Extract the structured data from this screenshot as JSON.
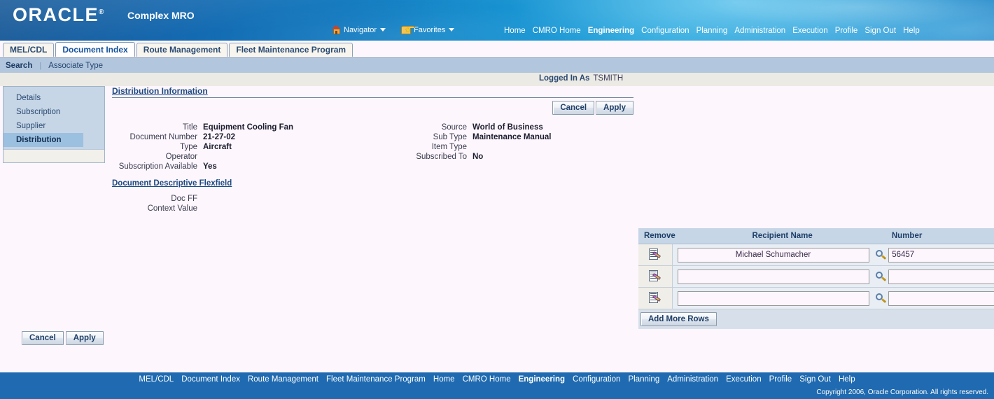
{
  "branding": {
    "logo_text": "ORACLE",
    "logo_registered": "®",
    "app_title": "Complex MRO"
  },
  "global_tools": [
    {
      "label": "Navigator",
      "icon": "house-icon"
    },
    {
      "label": "Favorites",
      "icon": "folder-star-icon"
    }
  ],
  "global_nav": [
    {
      "label": "Home",
      "current": false
    },
    {
      "label": "CMRO Home",
      "current": false
    },
    {
      "label": "Engineering",
      "current": true
    },
    {
      "label": "Configuration",
      "current": false
    },
    {
      "label": "Planning",
      "current": false
    },
    {
      "label": "Administration",
      "current": false
    },
    {
      "label": "Execution",
      "current": false
    },
    {
      "label": "Profile",
      "current": false
    },
    {
      "label": "Sign Out",
      "current": false
    },
    {
      "label": "Help",
      "current": false
    }
  ],
  "tabs": [
    {
      "label": "MEL/CDL",
      "selected": false
    },
    {
      "label": "Document Index",
      "selected": true
    },
    {
      "label": "Route Management",
      "selected": false
    },
    {
      "label": "Fleet Maintenance Program",
      "selected": false
    }
  ],
  "subtabs": [
    {
      "label": "Search",
      "selected": true
    },
    {
      "label": "Associate Type",
      "selected": false
    }
  ],
  "login": {
    "label": "Logged In As",
    "user": "TSMITH"
  },
  "sidemenu": {
    "items": [
      {
        "label": "Details",
        "selected": false
      },
      {
        "label": "Subscription",
        "selected": false
      },
      {
        "label": "Supplier",
        "selected": false
      },
      {
        "label": "Distribution",
        "selected": true
      }
    ]
  },
  "section": {
    "title": "Distribution Information",
    "cancel_label": "Cancel",
    "apply_label": "Apply"
  },
  "fields": {
    "left": [
      {
        "label": "Title",
        "value": "Equipment Cooling Fan"
      },
      {
        "label": "Document Number",
        "value": "21-27-02"
      },
      {
        "label": "Type",
        "value": "Aircraft"
      },
      {
        "label": "Operator",
        "value": ""
      },
      {
        "label": "Subscription Available",
        "value": "Yes"
      }
    ],
    "right": [
      {
        "label": "Source",
        "value": "World of Business"
      },
      {
        "label": "Sub Type",
        "value": "Maintenance Manual"
      },
      {
        "label": "Item Type",
        "value": ""
      },
      {
        "label": "Subscribed To",
        "value": "No"
      }
    ]
  },
  "flexfield": {
    "title": "Document Descriptive Flexfield",
    "rows": [
      {
        "label": "Doc FF",
        "value": ""
      },
      {
        "label": "Context Value",
        "value": ""
      }
    ]
  },
  "recipients": {
    "headers": {
      "remove": "Remove",
      "name": "Recipient Name",
      "number": "Number"
    },
    "rows": [
      {
        "name": "Michael Schumacher",
        "number": "56457"
      },
      {
        "name": "",
        "number": ""
      },
      {
        "name": "",
        "number": ""
      }
    ],
    "add_rows_label": "Add More Rows"
  },
  "bottom_buttons": {
    "cancel_label": "Cancel",
    "apply_label": "Apply"
  },
  "footer_nav": [
    {
      "label": "MEL/CDL",
      "current": false
    },
    {
      "label": "Document Index",
      "current": false
    },
    {
      "label": "Route Management",
      "current": false
    },
    {
      "label": "Fleet Maintenance Program",
      "current": false
    },
    {
      "label": "Home",
      "current": false
    },
    {
      "label": "CMRO Home",
      "current": false
    },
    {
      "label": "Engineering",
      "current": true
    },
    {
      "label": "Configuration",
      "current": false
    },
    {
      "label": "Planning",
      "current": false
    },
    {
      "label": "Administration",
      "current": false
    },
    {
      "label": "Execution",
      "current": false
    },
    {
      "label": "Profile",
      "current": false
    },
    {
      "label": "Sign Out",
      "current": false
    },
    {
      "label": "Help",
      "current": false
    }
  ],
  "copyright": "Copyright 2006, Oracle Corporation. All rights reserved."
}
